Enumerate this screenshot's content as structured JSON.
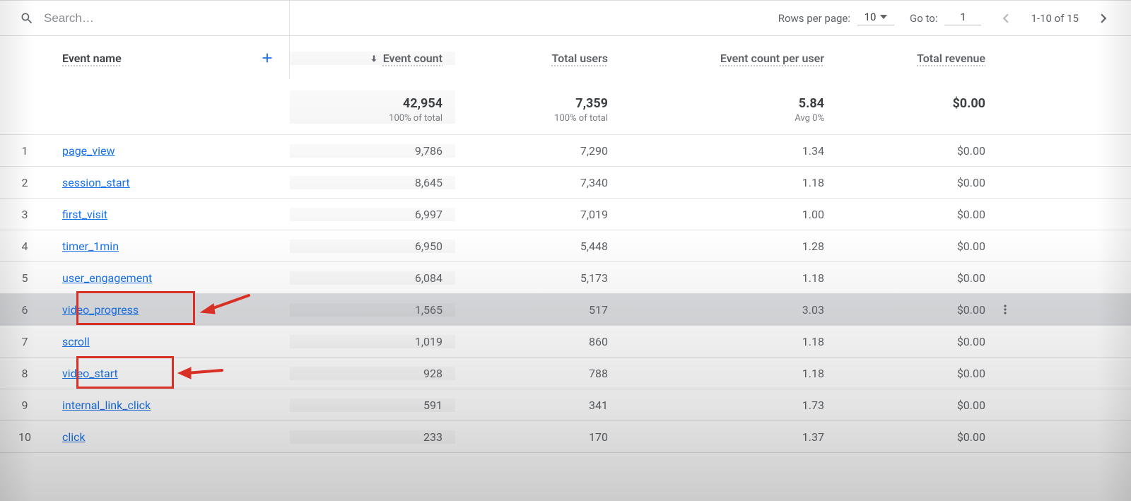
{
  "search": {
    "placeholder": "Search…"
  },
  "pager": {
    "rows_label": "Rows per page:",
    "rows_value": "10",
    "goto_label": "Go to:",
    "goto_value": "1",
    "range": "1-10 of 15"
  },
  "columns": {
    "dimension": "Event name",
    "metric1": "Event count",
    "metric2": "Total users",
    "metric3": "Event count per user",
    "metric4": "Total revenue"
  },
  "totals": {
    "event_count": "42,954",
    "event_count_sub": "100% of total",
    "total_users": "7,359",
    "total_users_sub": "100% of total",
    "count_per_user": "5.84",
    "count_per_user_sub": "Avg 0%",
    "revenue": "$0.00"
  },
  "rows": [
    {
      "idx": "1",
      "name": "page_view",
      "event_count": "9,786",
      "total_users": "7,290",
      "cpu": "1.34",
      "rev": "$0.00"
    },
    {
      "idx": "2",
      "name": "session_start",
      "event_count": "8,645",
      "total_users": "7,340",
      "cpu": "1.18",
      "rev": "$0.00"
    },
    {
      "idx": "3",
      "name": "first_visit",
      "event_count": "6,997",
      "total_users": "7,019",
      "cpu": "1.00",
      "rev": "$0.00"
    },
    {
      "idx": "4",
      "name": "timer_1min",
      "event_count": "6,950",
      "total_users": "5,448",
      "cpu": "1.28",
      "rev": "$0.00"
    },
    {
      "idx": "5",
      "name": "user_engagement",
      "event_count": "6,084",
      "total_users": "5,173",
      "cpu": "1.18",
      "rev": "$0.00"
    },
    {
      "idx": "6",
      "name": "video_progress",
      "event_count": "1,565",
      "total_users": "517",
      "cpu": "3.03",
      "rev": "$0.00",
      "hover": true
    },
    {
      "idx": "7",
      "name": "scroll",
      "event_count": "1,019",
      "total_users": "860",
      "cpu": "1.18",
      "rev": "$0.00"
    },
    {
      "idx": "8",
      "name": "video_start",
      "event_count": "928",
      "total_users": "788",
      "cpu": "1.18",
      "rev": "$0.00"
    },
    {
      "idx": "9",
      "name": "internal_link_click",
      "event_count": "591",
      "total_users": "341",
      "cpu": "1.73",
      "rev": "$0.00"
    },
    {
      "idx": "10",
      "name": "click",
      "event_count": "233",
      "total_users": "170",
      "cpu": "1.37",
      "rev": "$0.00"
    }
  ],
  "chart_data": {
    "type": "table",
    "dimension": "Event name",
    "metrics": [
      "Event count",
      "Total users",
      "Event count per user",
      "Total revenue"
    ],
    "totals": {
      "Event count": 42954,
      "Total users": 7359,
      "Event count per user": 5.84,
      "Total revenue": 0.0
    },
    "rows": [
      {
        "Event name": "page_view",
        "Event count": 9786,
        "Total users": 7290,
        "Event count per user": 1.34,
        "Total revenue": 0.0
      },
      {
        "Event name": "session_start",
        "Event count": 8645,
        "Total users": 7340,
        "Event count per user": 1.18,
        "Total revenue": 0.0
      },
      {
        "Event name": "first_visit",
        "Event count": 6997,
        "Total users": 7019,
        "Event count per user": 1.0,
        "Total revenue": 0.0
      },
      {
        "Event name": "timer_1min",
        "Event count": 6950,
        "Total users": 5448,
        "Event count per user": 1.28,
        "Total revenue": 0.0
      },
      {
        "Event name": "user_engagement",
        "Event count": 6084,
        "Total users": 5173,
        "Event count per user": 1.18,
        "Total revenue": 0.0
      },
      {
        "Event name": "video_progress",
        "Event count": 1565,
        "Total users": 517,
        "Event count per user": 3.03,
        "Total revenue": 0.0
      },
      {
        "Event name": "scroll",
        "Event count": 1019,
        "Total users": 860,
        "Event count per user": 1.18,
        "Total revenue": 0.0
      },
      {
        "Event name": "video_start",
        "Event count": 928,
        "Total users": 788,
        "Event count per user": 1.18,
        "Total revenue": 0.0
      },
      {
        "Event name": "internal_link_click",
        "Event count": 591,
        "Total users": 341,
        "Event count per user": 1.73,
        "Total revenue": 0.0
      },
      {
        "Event name": "click",
        "Event count": 233,
        "Total users": 170,
        "Event count per user": 1.37,
        "Total revenue": 0.0
      }
    ]
  }
}
